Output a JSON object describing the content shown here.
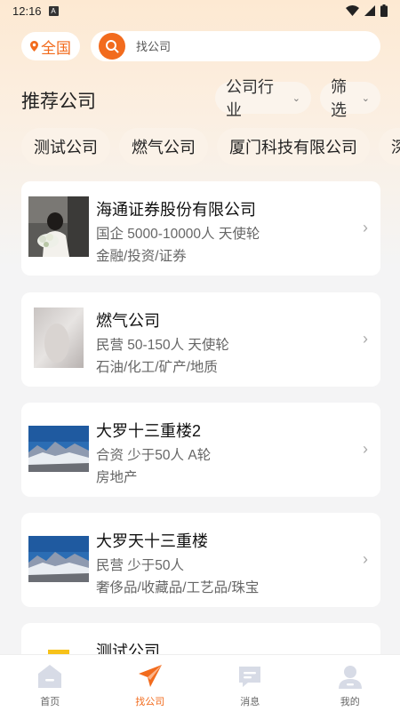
{
  "status_bar": {
    "time": "12:16",
    "notif": "A"
  },
  "location": {
    "label": "全国",
    "icon": "location-pin-icon"
  },
  "search": {
    "placeholder": "找公司",
    "icon": "search-icon"
  },
  "title": "推荐公司",
  "filters": [
    {
      "label": "公司行业",
      "icon": "chevron-down-icon"
    },
    {
      "label": "筛选",
      "icon": "chevron-down-icon"
    }
  ],
  "tags": [
    "测试公司",
    "燃气公司",
    "厦门科技有限公司",
    "深"
  ],
  "companies": [
    {
      "name": "海通证券股份有限公司",
      "meta": "国企  5000-10000人  天使轮",
      "tags": "金融/投资/证券",
      "thumb": "photo-person-flowers"
    },
    {
      "name": "燃气公司",
      "meta": "民营  50-150人  天使轮",
      "tags": "石油/化工/矿产/地质",
      "thumb": "photo-blurry"
    },
    {
      "name": "大罗十三重楼2",
      "meta": "合资  少于50人  A轮",
      "tags": "房地产",
      "thumb": "photo-mountain"
    },
    {
      "name": "大罗天十三重楼",
      "meta": "民营  少于50人",
      "tags": "奢侈品/收藏品/工艺品/珠宝",
      "thumb": "photo-mountain"
    },
    {
      "name": "测试公司",
      "meta": "",
      "tags": "",
      "thumb": "photo-yellow"
    }
  ],
  "nav": [
    {
      "label": "首页",
      "icon": "home-icon",
      "active": false
    },
    {
      "label": "找公司",
      "icon": "send-icon",
      "active": true
    },
    {
      "label": "消息",
      "icon": "message-icon",
      "active": false
    },
    {
      "label": "我的",
      "icon": "profile-icon",
      "active": false
    }
  ],
  "colors": {
    "accent": "#f26b1d",
    "background": "#f4f4f5",
    "header_gradient": "#fde9d2"
  }
}
